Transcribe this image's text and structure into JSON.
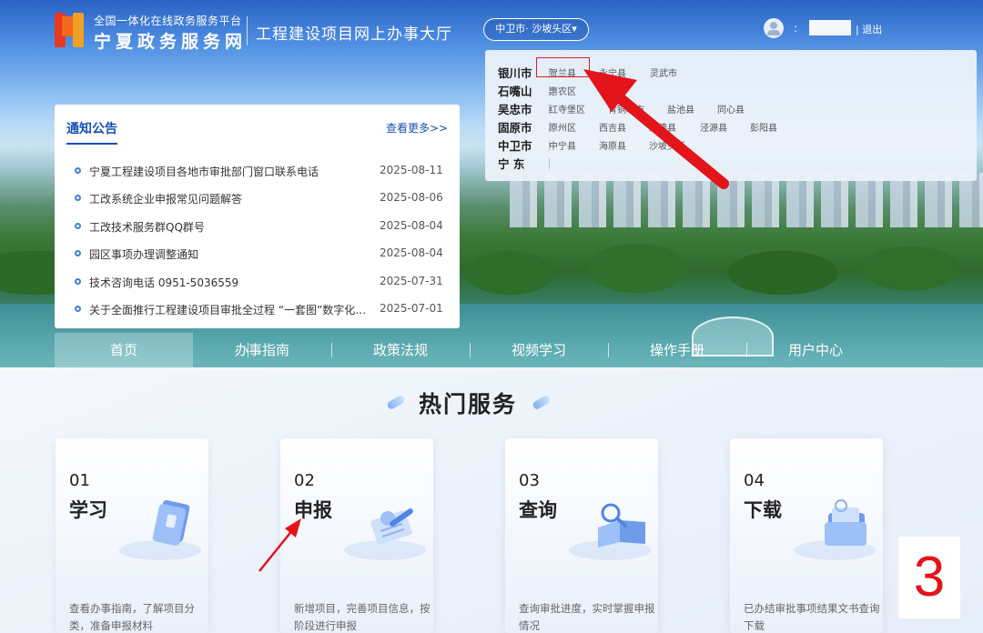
{
  "header": {
    "logo_small": "全国一体化在线政务服务平台",
    "logo_big": "宁夏政务服务网",
    "portal_title": "工程建设项目网上办事大厅",
    "region_selector": "中卫市· 沙坡头区▾",
    "user_colon": ":",
    "logout": "| 退出"
  },
  "region_dropdown": {
    "rows": [
      {
        "city": "银川市",
        "counties": [
          "贺兰县",
          "永宁县",
          "灵武市"
        ]
      },
      {
        "city": "石嘴山",
        "counties": [
          "惠农区",
          "平罗县"
        ]
      },
      {
        "city": "吴忠市",
        "counties": [
          "红寺堡区",
          "青铜峡市",
          "盐池县",
          "同心县"
        ]
      },
      {
        "city": "固原市",
        "counties": [
          "原州区",
          "西吉县",
          "隆德县",
          "泾源县",
          "彭阳县"
        ]
      },
      {
        "city": "中卫市",
        "counties": [
          "中宁县",
          "海原县",
          "沙坡头区"
        ]
      },
      {
        "city": "宁  东",
        "counties": []
      }
    ]
  },
  "notice": {
    "title": "通知公告",
    "more": "查看更多>>",
    "items": [
      {
        "text": "宁夏工程建设项目各地市审批部门窗口联系电话",
        "date": "2025-08-11"
      },
      {
        "text": "工改系统企业申报常见问题解答",
        "date": "2025-08-06"
      },
      {
        "text": "工改技术服务群QQ群号",
        "date": "2025-08-04"
      },
      {
        "text": "园区事项办理调整通知",
        "date": "2025-08-04"
      },
      {
        "text": "技术咨询电话 0951-5036559",
        "date": "2025-07-31"
      },
      {
        "text": "关于全面推行工程建设项目审批全过程 “一套图”数字化审查的通知",
        "date": "2025-07-01"
      }
    ]
  },
  "nav": {
    "items": [
      "首页",
      "办事指南",
      "政策法规",
      "视频学习",
      "操作手册",
      "用户中心"
    ],
    "active": "首页"
  },
  "hot_services": {
    "title": "热门服务",
    "cards": [
      {
        "num": "01",
        "title": "学习",
        "desc": "查看办事指南，了解项目分类，准备申报材料",
        "icon": "book-icon"
      },
      {
        "num": "02",
        "title": "申报",
        "desc": "新增项目，完善项目信息，按阶段进行申报",
        "icon": "form-pen-icon"
      },
      {
        "num": "03",
        "title": "查询",
        "desc": "查询审批进度，实时掌握申报情况",
        "icon": "magnifier-book-icon"
      },
      {
        "num": "04",
        "title": "下载",
        "desc": "已办结审批事项结果文书查询下载",
        "icon": "folder-download-icon"
      }
    ]
  },
  "step_badge": "3",
  "colors": {
    "primary": "#1850b8",
    "annotation_red": "#e3141a",
    "logo_red": "#e93a1f",
    "logo_orange": "#f0a020"
  }
}
